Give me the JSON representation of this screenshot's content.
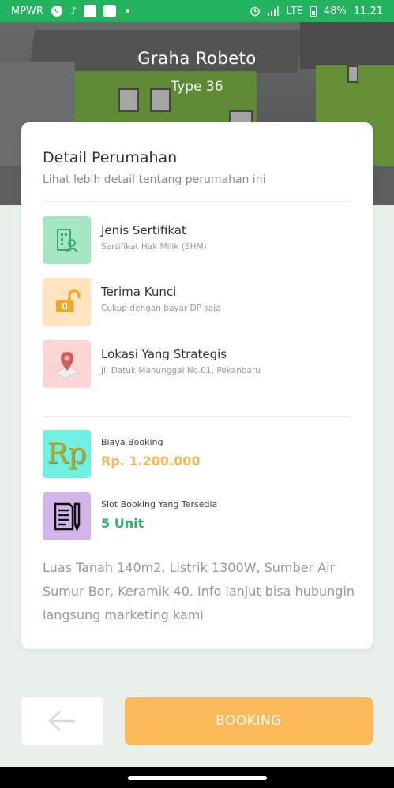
{
  "status_bar": {
    "carrier": "MPWR",
    "network": "LTE",
    "battery": "48%",
    "time": "11.21",
    "icons": [
      "whatsapp-icon",
      "tiktok-icon",
      "app-icon",
      "app-icon",
      "dot-icon",
      "alarm-icon",
      "signal-icon",
      "battery-icon"
    ]
  },
  "header": {
    "title": "Graha Robeto",
    "subtitle": "Type 36"
  },
  "detail": {
    "title": "Detail Perumahan",
    "subtitle": "Lihat lebih detail tentang perumahan ini"
  },
  "features": [
    {
      "title": "Jenis Sertifikat",
      "subtitle": "Sertifikat Hak Milik (SHM)",
      "icon": "certificate-building-icon",
      "color": "#a5e6c3"
    },
    {
      "title": "Terima Kunci",
      "subtitle": "Cukup dengan bayar DP saja",
      "icon": "unlocked-padlock-icon",
      "color": "#ffe4c0"
    },
    {
      "title": "Lokasi Yang Strategis",
      "subtitle": "Jl. Datuk Manunggal No.01, Pekanbaru",
      "icon": "map-pin-icon",
      "color": "#fbd6d4"
    }
  ],
  "booking_info": {
    "fee_label": "Biaya Booking",
    "fee_value": "Rp. 1.200.000",
    "fee_icon_text": "Rp",
    "fee_color": "#f5b958",
    "slot_label": "Slot Booking Yang Tersedia",
    "slot_value": "5 Unit",
    "slot_color": "#2db46a"
  },
  "description": "Luas Tanah 140m2, Listrik 1300W, Sumber Air Sumur Bor, Keramik 40. Info lanjut bisa hubungin langsung marketing kami",
  "actions": {
    "booking_label": "BOOKING"
  },
  "colors": {
    "status_bar": "#23b35f",
    "accent": "#fcb95a",
    "background": "#e9f0ea"
  }
}
